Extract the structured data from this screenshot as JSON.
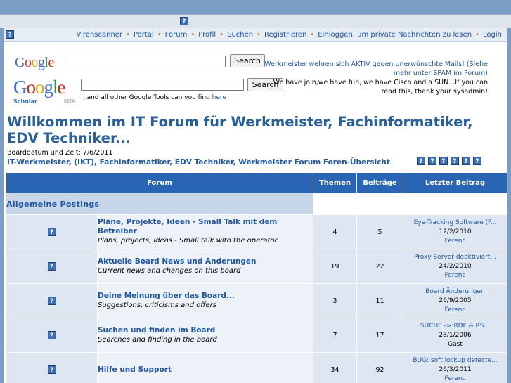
{
  "nav": {
    "links": [
      "Virenscanner",
      "Portal",
      "Forum",
      "Profil",
      "Suchen",
      "Registrieren",
      "Einloggen, um private Nachrichten zu lesen",
      "Login"
    ]
  },
  "google": {
    "search_button_1": "Search",
    "search_button_2": "Search",
    "scholar_label": "Scholar",
    "beta_label": "BETA",
    "tools_text": "...and all other Google Tools can you find",
    "tools_link": "here"
  },
  "ads": {
    "line1": "Werkmeister wehren sich AKTIV gegen unerwünschte Mails! (Siehe mehr unter SPAM im Forum)",
    "line2": "We have join,we have fun, we have Cisco and a SUN...If you can read this, thank your sysadmin!"
  },
  "site_title": "Willkommen im IT Forum für Werkmeister, Fachinformatiker, EDV Techniker...",
  "board_date": "Boarddatum und Zeit: 7/6/2011",
  "breadcrumb": "IT-Werkmeister, (IKT), Fachinformatiker, EDV Techniker, Werkmeister Forum Foren-Übersicht",
  "table": {
    "headers": {
      "forum": "Forum",
      "topics": "Themen",
      "posts": "Beiträge",
      "last_post": "Letzter Beitrag"
    },
    "category": "Allgemeine Postings",
    "rows": [
      {
        "name": "Pläne, Projekte, Ideen - Small Talk mit dem Betreiber",
        "desc": "Plans, projects, ideas - Small talk with the operator",
        "topics": "4",
        "posts": "5",
        "last_title": "Eye-Tracking Software (F...",
        "last_date": "12/2/2010",
        "last_user": "Ferenc"
      },
      {
        "name": "Aktuelle Board News und Änderungen",
        "desc": "Current news and changes on this board",
        "topics": "19",
        "posts": "22",
        "last_title": "Proxy Server deaktiviert...",
        "last_date": "24/2/2010",
        "last_user": "Ferenc"
      },
      {
        "name": "Deine Meinung über das Board...",
        "desc": "Suggestions, criticisms and offers",
        "topics": "3",
        "posts": "11",
        "last_title": "Board Änderungen",
        "last_date": "26/9/2005",
        "last_user": "Ferenc"
      },
      {
        "name": "Suchen und finden im Board",
        "desc": "Searches and finding in the board",
        "topics": "7",
        "posts": "17",
        "last_title": "SUCHE -> RDF & RS...",
        "last_date": "28/1/2006",
        "last_user": "Gast"
      },
      {
        "name": "Hilfe und Support",
        "desc": "",
        "topics": "34",
        "posts": "92",
        "last_title": "BUG: soft lockup detecte...",
        "last_date": "26/3/2011",
        "last_user": "Ferenc"
      }
    ]
  },
  "icons": {
    "placeholder": "?"
  }
}
